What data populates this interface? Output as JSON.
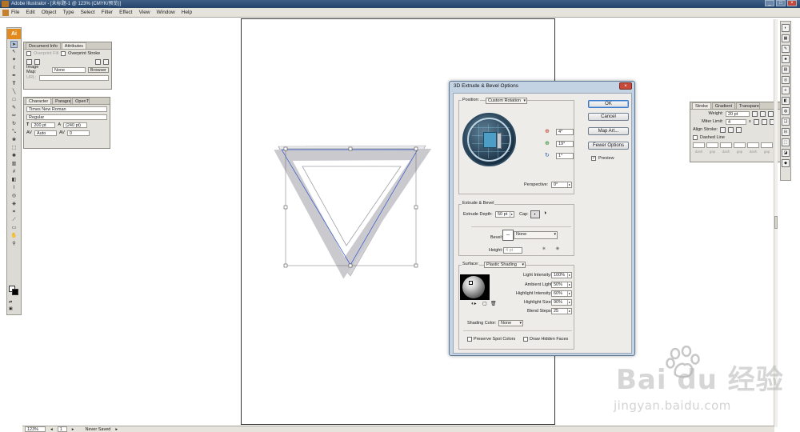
{
  "window": {
    "title": "Adobe Illustrator - [未标题-1 @ 123% (CMYK/预览)]",
    "controls": [
      "_",
      "□",
      "×"
    ]
  },
  "menubar": {
    "items": [
      "File",
      "Edit",
      "Object",
      "Type",
      "Select",
      "Filter",
      "Effect",
      "View",
      "Window",
      "Help"
    ]
  },
  "toolbar": {
    "logo": "Ai"
  },
  "attributes_panel": {
    "tabs": [
      "Document Info",
      "Attributes"
    ],
    "overprint_fill": "Overprint Fill",
    "overprint_stroke": "Overprint Stroke",
    "image_map_label": "Image Map:",
    "image_map_value": "None",
    "browser_button": "Browser",
    "url_label": "URL:"
  },
  "character_panel": {
    "tabs": [
      "Character",
      "Paragraph",
      "OpenType"
    ],
    "font_family": "Times New Roman",
    "font_style": "Regular",
    "font_size": "200 pt",
    "leading": "(240 pt)",
    "kerning": "Auto",
    "tracking": "0"
  },
  "dialog": {
    "title": "3D Extrude & Bevel Options",
    "close": "×",
    "position_label": "Position:",
    "position_value": "Custom Rotation",
    "rot_x": "4°",
    "rot_y": "19°",
    "rot_z": "1°",
    "perspective_label": "Perspective:",
    "perspective_value": "0°",
    "extrude_bevel_label": "Extrude & Bevel",
    "extrude_depth_label": "Extrude Depth:",
    "extrude_depth_value": "50 pt",
    "cap_label": "Cap:",
    "bevel_label": "Bevel:",
    "bevel_value": "None",
    "height_label": "Height:",
    "height_value": "4 pt",
    "surface_label": "Surface:",
    "surface_value": "Plastic Shading",
    "lighting": [
      {
        "label": "Light Intensity:",
        "value": "100%"
      },
      {
        "label": "Ambient Light:",
        "value": "50%"
      },
      {
        "label": "Highlight Intensity:",
        "value": "60%"
      },
      {
        "label": "Highlight Size:",
        "value": "90%"
      },
      {
        "label": "Blend Steps:",
        "value": "25"
      }
    ],
    "shading_color_label": "Shading Color:",
    "shading_color_value": "None",
    "preserve_spot": "Preserve Spot Colors",
    "draw_hidden": "Draw Hidden Faces",
    "buttons": {
      "ok": "OK",
      "cancel": "Cancel",
      "map_art": "Map Art...",
      "fewer_options": "Fewer Options"
    },
    "preview_label": "Preview",
    "preview_checked": true
  },
  "stroke_panel": {
    "tabs": [
      "Stroke",
      "Gradient",
      "Transparency"
    ],
    "weight_label": "Weight:",
    "weight_value": "20 pt",
    "miter_label": "Miter Limit:",
    "miter_value": "4",
    "miter_unit": "x",
    "align_label": "Align Stroke:",
    "dashed_label": "Dashed Line",
    "dash_labels": [
      "dash",
      "gap",
      "dash",
      "gap",
      "dash",
      "gap"
    ]
  },
  "statusbar": {
    "zoom": "123%",
    "page": "1",
    "status": "Never Saved"
  },
  "watermark": {
    "brand": "Bai du 经验",
    "url": "jingyan.baidu.com"
  },
  "colors": {
    "accent": "#e28a1d",
    "dialog_frame": "#c3d3e4",
    "selection": "#3355cc"
  }
}
